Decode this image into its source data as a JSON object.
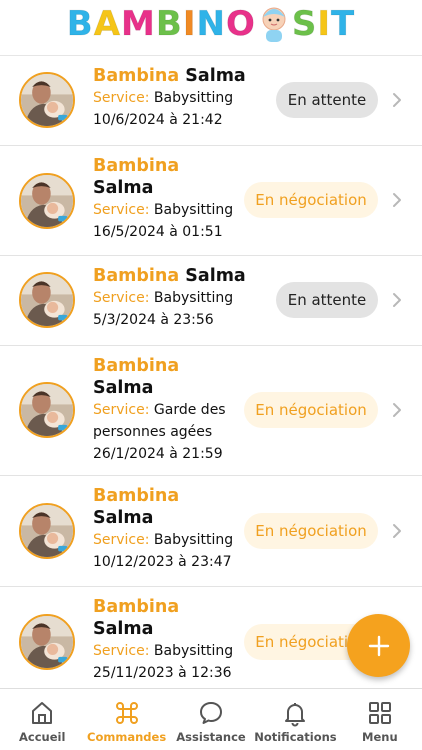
{
  "app": {
    "logo_text": "BAMBINO SIT",
    "brand_colors": {
      "accent": "#f0a020",
      "status_waiting_bg": "#e3e3e3",
      "status_negotiation_bg": "#fff5e2"
    }
  },
  "orders": [
    {
      "first_name": "Bambina",
      "last_name": "Salma",
      "service_label": "Service:",
      "service": "Babysitting",
      "service_cont": "",
      "date": "10/6/2024 à 21:42",
      "status": "En attente",
      "status_type": "waiting"
    },
    {
      "first_name": "Bambina",
      "last_name": "Salma",
      "service_label": "Service:",
      "service": "Babysitting",
      "service_cont": "",
      "date": "16/5/2024 à 01:51",
      "status": "En négociation",
      "status_type": "negotiation"
    },
    {
      "first_name": "Bambina",
      "last_name": "Salma",
      "service_label": "Service:",
      "service": "Babysitting",
      "service_cont": "",
      "date": "5/3/2024 à 23:56",
      "status": "En attente",
      "status_type": "waiting"
    },
    {
      "first_name": "Bambina",
      "last_name": "Salma",
      "service_label": "Service:",
      "service": "Garde des",
      "service_cont": "personnes agées",
      "date": "26/1/2024 à 21:59",
      "status": "En négociation",
      "status_type": "negotiation"
    },
    {
      "first_name": "Bambina",
      "last_name": "Salma",
      "service_label": "Service:",
      "service": "Babysitting",
      "service_cont": "",
      "date": "10/12/2023 à 23:47",
      "status": "En négociation",
      "status_type": "negotiation"
    },
    {
      "first_name": "Bambina",
      "last_name": "Salma",
      "service_label": "Service:",
      "service": "Babysitting",
      "service_cont": "",
      "date": "25/11/2023 à 12:36",
      "status": "En négociation",
      "status_type": "negotiation"
    }
  ],
  "fab": {
    "icon": "plus-icon"
  },
  "tabbar": {
    "tabs": [
      {
        "label": "Accueil",
        "icon": "home-icon",
        "active": false
      },
      {
        "label": "Commandes",
        "icon": "command-icon",
        "active": true
      },
      {
        "label": "Assistance",
        "icon": "chat-bubble-icon",
        "active": false
      },
      {
        "label": "Notifications",
        "icon": "bell-icon",
        "active": false
      },
      {
        "label": "Menu",
        "icon": "grid-icon",
        "active": false
      }
    ]
  }
}
